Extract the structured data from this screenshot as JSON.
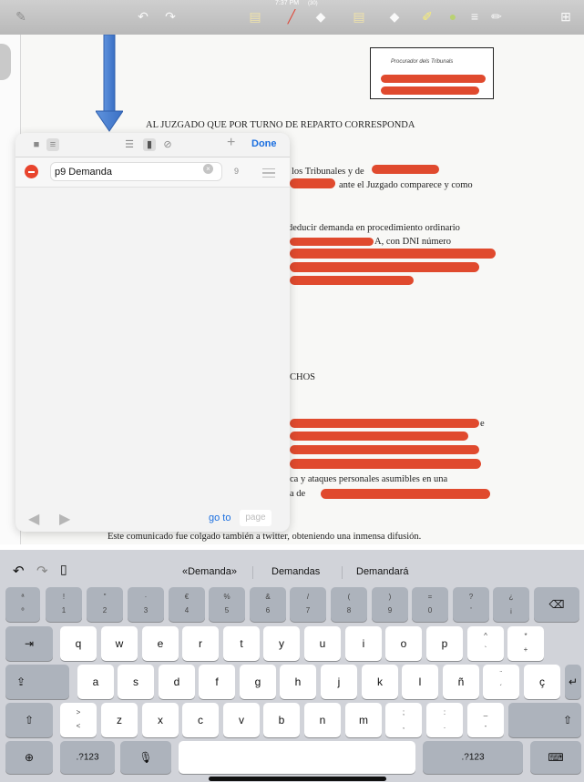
{
  "status": {
    "time": "7:37 PM",
    "badge": "(30)"
  },
  "toolbar": {
    "icons": [
      "pen-icon",
      "undo-icon",
      "redo-icon",
      "sticky-note-icon",
      "highlighter-icon",
      "eraser-icon",
      "note-icon",
      "eraser-alt-icon",
      "lasso-icon",
      "color-dot-icon",
      "size-icon",
      "pencil-icon",
      "crop-icon"
    ]
  },
  "document": {
    "heading": "AL JUZGADO QUE POR TURNO DE REPARTO CORRESPONDA",
    "stamp_text": "Procurador dels Tribunals",
    "lines": [
      "los Tribunales y de",
      "ante el Juzgado comparece y como",
      "deducir demanda en procedimiento ordinario",
      "A, con DNI número",
      "CHOS",
      "e",
      "ca y ataques personales asumibles en una",
      "a de",
      "Este comunicado fue colgado también a twitter, obteniendo una inmensa difusión."
    ]
  },
  "bookmarks": {
    "done_label": "Done",
    "plus_label": "+",
    "items": [
      {
        "title": "p9 Demanda",
        "page": "9"
      }
    ],
    "goto_label": "go to",
    "page_placeholder": "page"
  },
  "keyboard": {
    "suggestions": [
      "«Demanda»",
      "Demandas",
      "Demandará"
    ],
    "number_row": [
      {
        "top": "ª",
        "bottom": "º"
      },
      {
        "top": "!",
        "bottom": "1"
      },
      {
        "top": "\"",
        "bottom": "2"
      },
      {
        "top": "·",
        "bottom": "3"
      },
      {
        "top": "€",
        "bottom": "4"
      },
      {
        "top": "%",
        "bottom": "5"
      },
      {
        "top": "&",
        "bottom": "6"
      },
      {
        "top": "/",
        "bottom": "7"
      },
      {
        "top": "(",
        "bottom": "8"
      },
      {
        "top": ")",
        "bottom": "9"
      },
      {
        "top": "=",
        "bottom": "0"
      },
      {
        "top": "?",
        "bottom": "'"
      },
      {
        "top": "¿",
        "bottom": "¡"
      }
    ],
    "row_q": [
      "q",
      "w",
      "e",
      "r",
      "t",
      "y",
      "u",
      "i",
      "o",
      "p"
    ],
    "row_q_extra": [
      {
        "top": "^",
        "bottom": "`"
      },
      {
        "top": "*",
        "bottom": "+"
      }
    ],
    "row_a": [
      "a",
      "s",
      "d",
      "f",
      "g",
      "h",
      "j",
      "k",
      "l",
      "ñ"
    ],
    "row_a_extra": [
      {
        "top": "¨",
        "bottom": "´"
      },
      {
        "top": "",
        "bottom": "ç"
      }
    ],
    "row_z": [
      "z",
      "x",
      "c",
      "v",
      "b",
      "n",
      "m"
    ],
    "row_z_extra": [
      {
        "top": ">",
        "bottom": "<"
      },
      {
        "top": ";",
        "bottom": ","
      },
      {
        "top": ":",
        "bottom": "."
      },
      {
        "top": "_",
        "bottom": "-"
      }
    ],
    "numeric_label": ".?123"
  }
}
